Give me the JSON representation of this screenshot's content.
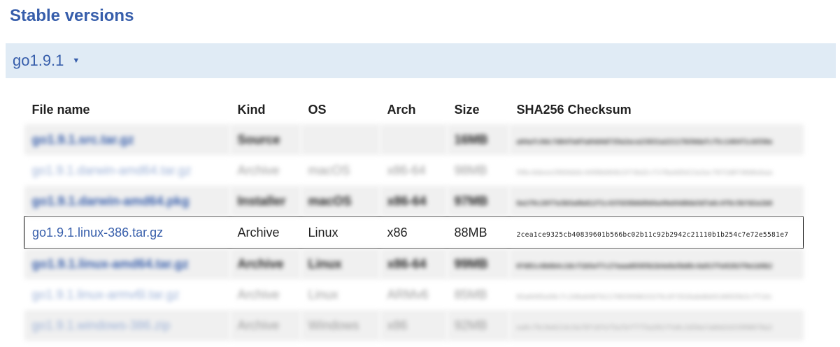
{
  "section": {
    "title": "Stable versions"
  },
  "version": {
    "label": "go1.9.1",
    "toggle_icon": "caret-down-icon"
  },
  "table": {
    "headers": {
      "file_name": "File name",
      "kind": "Kind",
      "os": "OS",
      "arch": "Arch",
      "size": "Size",
      "checksum": "SHA256 Checksum"
    },
    "rows": [
      {
        "file_name": "go1.9.1.src.tar.gz",
        "kind": "Source",
        "os": "",
        "arch": "",
        "size": "16MB",
        "checksum": "a84afc9dc7d64fe0fa84d4d735e2ece23831a22117b50dafc75c1484f1cb550e"
      },
      {
        "file_name": "go1.9.1.darwin-amd64.tar.gz",
        "kind": "Archive",
        "os": "macOS",
        "arch": "x86-64",
        "size": "98MB",
        "checksum": "59bc6deee2969dddc4490b684b15f3bd2cf1f8a4d5d13a3ac76f2d0f40d6ebaa"
      },
      {
        "file_name": "go1.9.1.darwin-amd64.pkg",
        "kind": "Installer",
        "os": "macOS",
        "arch": "x86-64",
        "size": "97MB",
        "checksum": "8a1f9c20f7e3b5a8bd12f1c43fd38b0d9d4a49e84d0de5d7a6c4f8c5b7d2a1b0"
      },
      {
        "file_name": "go1.9.1.linux-386.tar.gz",
        "kind": "Archive",
        "os": "Linux",
        "arch": "x86",
        "size": "88MB",
        "checksum": "2cea1ce9325cb40839601b566bc02b11c92b2942c21110b1b254c7e72e5581e7"
      },
      {
        "file_name": "go1.9.1.linux-amd64.tar.gz",
        "kind": "Archive",
        "os": "Linux",
        "arch": "x86-64",
        "size": "99MB",
        "checksum": "07d81c6b6b4c2dcf1b5ef7c27eaad6505b1b4e8e5bd0c4a91ffe9202f9e1d4b2"
      },
      {
        "file_name": "go1.9.1.linux-armv6l.tar.gz",
        "kind": "Archive",
        "os": "Linux",
        "arch": "ARMv6",
        "size": "85MB",
        "checksum": "65a0495a50c7c240a6487b1170939586332f6c8f3526abdbb9140935b3cff14c"
      },
      {
        "file_name": "go1.9.1.windows-386.zip",
        "kind": "Archive",
        "os": "Windows",
        "arch": "x86",
        "size": "92MB",
        "checksum": "ea9c79c9e6214c9a78f107ef5a7bff775a281ffe8c2d50afa66d2d33998078a2"
      }
    ]
  }
}
